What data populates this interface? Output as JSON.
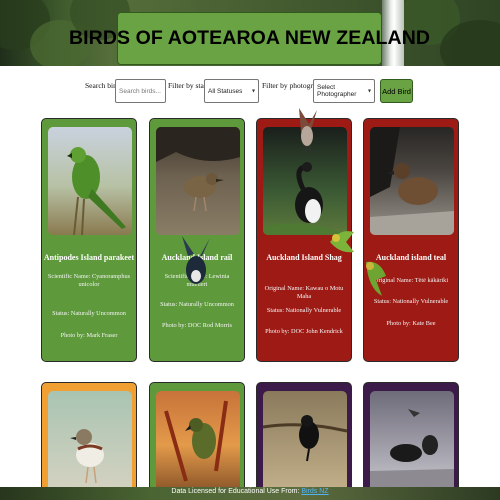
{
  "header": {
    "title": "BIRDS OF AOTEAROA NEW ZEALAND"
  },
  "filters": {
    "search_label": "Search birds:",
    "search_placeholder": "Search birds...",
    "status_label": "Filter by status:",
    "status_value": "All Statuses",
    "photographer_label": "Filter by photographer:",
    "photographer_value": "Select Photographer",
    "add_button": "Add Bird"
  },
  "cards": [
    {
      "name": "Antipodes Island parakeet",
      "line1": "Scientific Name: Cyanoramphus unicolor",
      "status": "Status: Naturally Uncommon",
      "photo": "Photo by: Mark Fraser",
      "color": "#5e9a3c"
    },
    {
      "name": "Auckland Island rail",
      "line1": "Scientific Name: Lewinia muelleri",
      "status": "Status: Naturally Uncommon",
      "photo": "Photo by: DOC Rod Morris",
      "color": "#5e9a3c"
    },
    {
      "name": "Auckland Island Shag",
      "line1": "Original Name: Kawau o Motu Maha",
      "status": "Status: Nationally Vulnerable",
      "photo": "Photo by: DOC John Kendrick",
      "color": "#9e1a14"
    },
    {
      "name": "Auckland island teal",
      "line1": "Original Name: Tētē kākāriki",
      "status": "Status: Nationally Vulnerable",
      "photo": "Photo by: Kate Bee",
      "color": "#9e1a14"
    }
  ],
  "row2_colors": [
    "#f0a033",
    "#5e9a3c",
    "#3c1a4a",
    "#3c1a4a"
  ],
  "footer": {
    "text": "Data Licensed for Educational Use From:",
    "link": "Birds NZ"
  }
}
